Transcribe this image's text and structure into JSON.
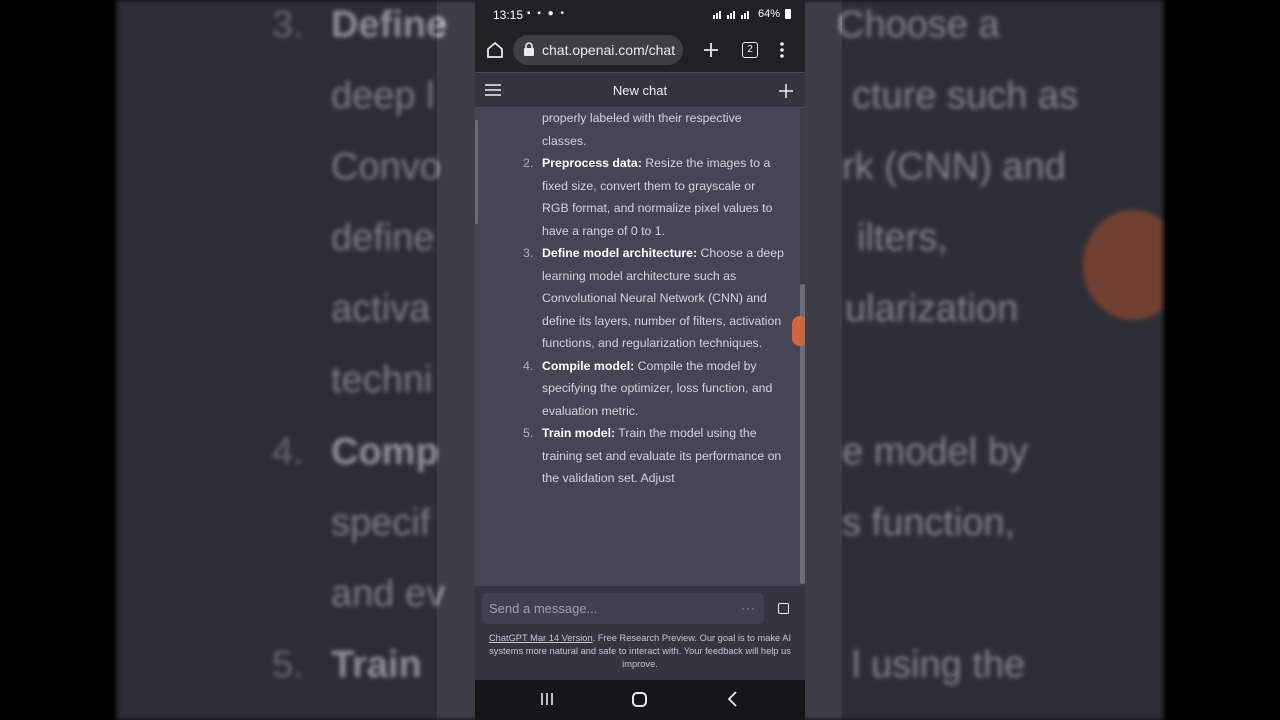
{
  "status_bar": {
    "time": "13:15",
    "left_icons": "▪ ▪ ● •",
    "battery": "64%"
  },
  "browser": {
    "url": "chat.openai.com/chat",
    "tab_count": "2"
  },
  "app": {
    "title": "New chat"
  },
  "chat": {
    "items": [
      {
        "number": "",
        "bold": "",
        "text": "properly labeled with their respective classes."
      },
      {
        "number": "2.",
        "bold": "Preprocess data:",
        "text": " Resize the images to a fixed size, convert them to grayscale or RGB format, and normalize pixel values to have a range of 0 to 1."
      },
      {
        "number": "3.",
        "bold": "Define model architecture:",
        "text": " Choose a deep learning model architecture such as Convolutional Neural Network (CNN) and define its layers, number of filters, activation functions, and regularization techniques."
      },
      {
        "number": "4.",
        "bold": "Compile model:",
        "text": " Compile the model by specifying the optimizer, loss function, and evaluation metric."
      },
      {
        "number": "5.",
        "bold": "Train model:",
        "text": " Train the model using the training set and evaluate its performance on the validation set. Adjust"
      }
    ]
  },
  "composer": {
    "placeholder": "Send a message...",
    "dots": "···"
  },
  "footer": {
    "link": "ChatGPT Mar 14 Version",
    "text": ". Free Research Preview. Our goal is to make AI systems more natural and safe to interact with. Your feedback will help us improve."
  },
  "background_zoom": {
    "lines": [
      {
        "num": "3.",
        "bold": "Define",
        "text": "Choose a"
      },
      {
        "num": "",
        "bold": "",
        "text": "deep l"
      },
      {
        "num": "",
        "bold": "",
        "text": "cture such as"
      },
      {
        "num": "",
        "bold": "",
        "text": "Convo"
      },
      {
        "num": "",
        "bold": "",
        "text": "rk (CNN) and"
      },
      {
        "num": "",
        "bold": "",
        "text": "define"
      },
      {
        "num": "",
        "bold": "",
        "text": "ilters,"
      },
      {
        "num": "",
        "bold": "",
        "text": "activa"
      },
      {
        "num": "",
        "bold": "",
        "text": "ularization"
      },
      {
        "num": "",
        "bold": "",
        "text": "techni"
      },
      {
        "num": "4.",
        "bold": "Comp",
        "text": ""
      },
      {
        "num": "",
        "bold": "",
        "text": "e model by"
      },
      {
        "num": "",
        "bold": "",
        "text": "specif"
      },
      {
        "num": "",
        "bold": "",
        "text": "s function,"
      },
      {
        "num": "",
        "bold": "",
        "text": "and ev"
      },
      {
        "num": "5.",
        "bold": "Train",
        "text": ""
      },
      {
        "num": "",
        "bold": "",
        "text": "l using the"
      }
    ]
  },
  "colors": {
    "chat_bg": "#444654",
    "header_bg": "#343541",
    "input_bg": "#40414f",
    "accent_dot": "#d1663d"
  }
}
